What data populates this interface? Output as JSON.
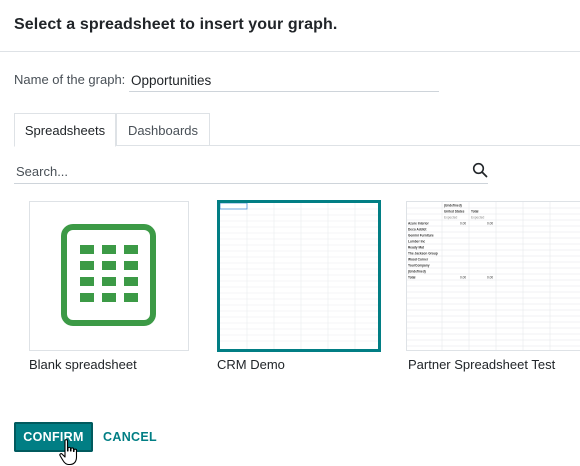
{
  "dialog": {
    "title": "Select a spreadsheet to insert your graph."
  },
  "graph_name": {
    "label": "Name of the graph:",
    "value": "Opportunities"
  },
  "tabs": [
    {
      "label": "Spreadsheets",
      "active": true
    },
    {
      "label": "Dashboards",
      "active": false
    }
  ],
  "search": {
    "placeholder": "Search..."
  },
  "spreadsheets": [
    {
      "label": "Blank spreadsheet",
      "icon": "spreadsheet-grid-icon",
      "selected": false
    },
    {
      "label": "CRM Demo",
      "selected": true
    },
    {
      "label": "Partner Spreadsheet Test",
      "selected": false
    }
  ],
  "partner_preview": {
    "col_headers": [
      "(Undefined)",
      "United States",
      "Total"
    ],
    "sub_headers": [
      "Expected",
      "Expected"
    ],
    "rows": [
      {
        "name": "Azure Interior",
        "a": "0.00",
        "b": "0.00"
      },
      {
        "name": "Deco Addict",
        "a": "",
        "b": ""
      },
      {
        "name": "Gemini Furniture",
        "a": "",
        "b": ""
      },
      {
        "name": "Lumber Inc",
        "a": "",
        "b": ""
      },
      {
        "name": "Ready Mat",
        "a": "",
        "b": ""
      },
      {
        "name": "The Jackson Group",
        "a": "",
        "b": ""
      },
      {
        "name": "Wood Corner",
        "a": "",
        "b": ""
      },
      {
        "name": "YourCompany",
        "a": "",
        "b": ""
      },
      {
        "name": "(Undefined)",
        "a": "",
        "b": ""
      },
      {
        "name": "Total",
        "a": "0.00",
        "b": "0.00"
      }
    ]
  },
  "footer": {
    "confirm_label": "CONFIRM",
    "cancel_label": "CANCEL"
  },
  "colors": {
    "primary": "#017e84",
    "icon_green": "#3c9a46"
  }
}
